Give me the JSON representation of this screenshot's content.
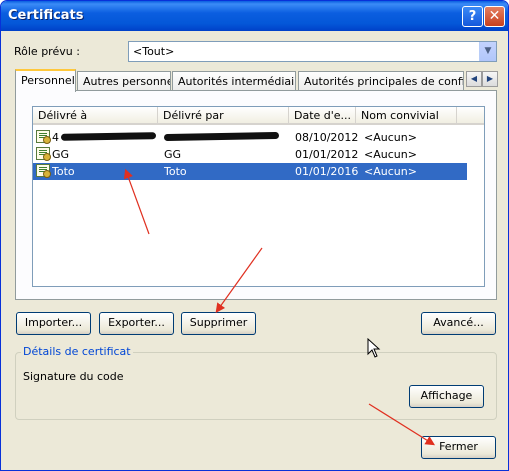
{
  "window": {
    "title": "Certificats",
    "help_glyph": "?",
    "close_glyph": "✕"
  },
  "purpose": {
    "label": "Rôle prévu :",
    "selected": "<Tout>",
    "dropdown_glyph": "▼"
  },
  "tabs": [
    {
      "label": "Personnel",
      "active": true
    },
    {
      "label": "Autres personnes",
      "active": false
    },
    {
      "label": "Autorités intermédiaires",
      "active": false
    },
    {
      "label": "Autorités principales de confiance",
      "active": false
    }
  ],
  "tab_scroll": {
    "left": "◀",
    "right": "▶"
  },
  "list": {
    "columns": [
      "Délivré à",
      "Délivré par",
      "Date d'e...",
      "Nom convivial"
    ],
    "rows": [
      {
        "issued_to": "4",
        "issued_by": "",
        "date": "08/10/2012",
        "friendly": "<Aucun>",
        "selected": false,
        "redacted": true
      },
      {
        "issued_to": "GG",
        "issued_by": "GG",
        "date": "01/01/2012",
        "friendly": "<Aucun>",
        "selected": false,
        "redacted": false
      },
      {
        "issued_to": "Toto",
        "issued_by": "Toto",
        "date": "01/01/2016",
        "friendly": "<Aucun>",
        "selected": true,
        "redacted": false
      }
    ]
  },
  "buttons": {
    "import": "Importer...",
    "export": "Exporter...",
    "remove": "Supprimer",
    "advanced": "Avancé...",
    "view": "Affichage",
    "close": "Fermer"
  },
  "details": {
    "title": "Détails de certificat",
    "purpose_text": "Signature du code"
  },
  "colors": {
    "selection": "#316ac5",
    "annotation_arrow": "#e03020",
    "group_title": "#0046d5"
  }
}
